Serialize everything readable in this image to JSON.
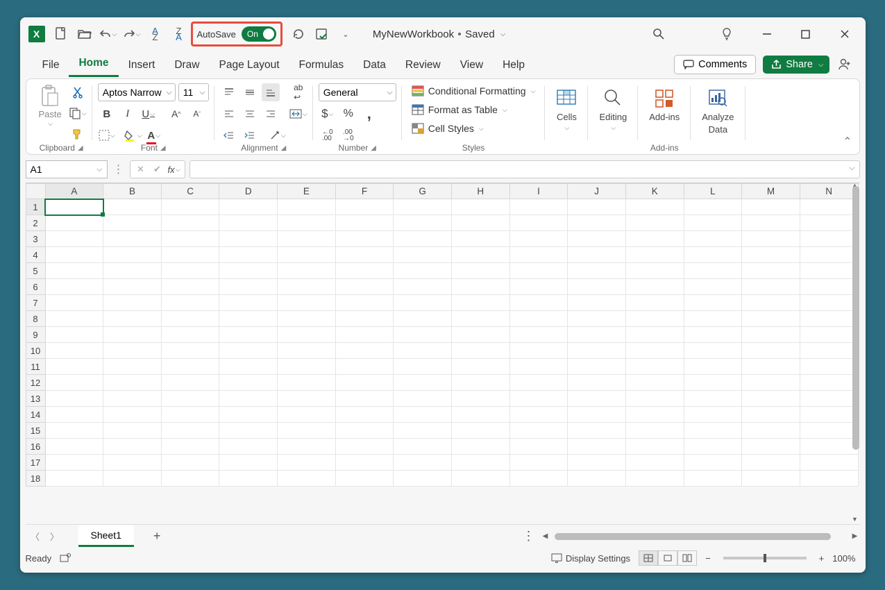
{
  "titlebar": {
    "autosave_label": "AutoSave",
    "autosave_state": "On",
    "doc_name": "MyNewWorkbook",
    "doc_status": "Saved"
  },
  "tabs": {
    "file": "File",
    "items": [
      "Home",
      "Insert",
      "Draw",
      "Page Layout",
      "Formulas",
      "Data",
      "Review",
      "View",
      "Help"
    ],
    "active": "Home",
    "comments": "Comments",
    "share": "Share"
  },
  "ribbon": {
    "clipboard": {
      "paste": "Paste",
      "label": "Clipboard"
    },
    "font": {
      "name": "Aptos Narrow",
      "size": "11",
      "label": "Font"
    },
    "alignment": {
      "label": "Alignment"
    },
    "number": {
      "format": "General",
      "label": "Number"
    },
    "styles": {
      "conditional": "Conditional Formatting",
      "format_as_table": "Format as Table",
      "cell_styles": "Cell Styles",
      "label": "Styles"
    },
    "cells": {
      "label": "Cells"
    },
    "editing": {
      "label": "Editing"
    },
    "addins": {
      "btn": "Add-ins",
      "label": "Add-ins"
    },
    "analyze": {
      "line1": "Analyze",
      "line2": "Data"
    }
  },
  "formula_bar": {
    "namebox": "A1",
    "formula": ""
  },
  "grid": {
    "columns": [
      "A",
      "B",
      "C",
      "D",
      "E",
      "F",
      "G",
      "H",
      "I",
      "J",
      "K",
      "L",
      "M",
      "N"
    ],
    "rows": [
      1,
      2,
      3,
      4,
      5,
      6,
      7,
      8,
      9,
      10,
      11,
      12,
      13,
      14,
      15,
      16,
      17,
      18
    ],
    "active_col": "A",
    "active_row": 1
  },
  "sheetbar": {
    "sheet": "Sheet1"
  },
  "statusbar": {
    "ready": "Ready",
    "display_settings": "Display Settings",
    "zoom": "100%"
  },
  "icons": {
    "excel": "X"
  }
}
